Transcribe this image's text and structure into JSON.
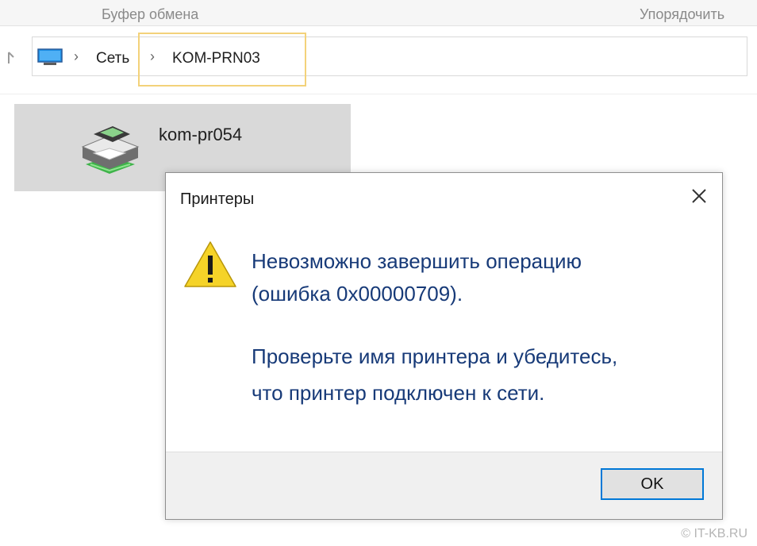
{
  "ribbon": {
    "clipboard_label": "Буфер обмена",
    "organize_label": "Упорядочить"
  },
  "address_bar": {
    "crumbs": [
      "Сеть",
      "KOM-PRN03"
    ],
    "separator": "›"
  },
  "printer_item": {
    "name": "kom-pr054"
  },
  "dialog": {
    "title": "Принтеры",
    "message_lines": [
      "Невозможно завершить операцию",
      "(ошибка 0x00000709).",
      "Проверьте имя принтера и убедитесь,",
      "что принтер подключен к сети."
    ],
    "ok_label": "OK",
    "close_icon": "close-icon",
    "warning_icon": "warning-icon"
  },
  "watermark": "© IT-KB.RU",
  "colors": {
    "accent": "#0078d7",
    "message_text": "#173a78",
    "highlight": "#f3d27a",
    "warning_yellow": "#f5d328"
  }
}
